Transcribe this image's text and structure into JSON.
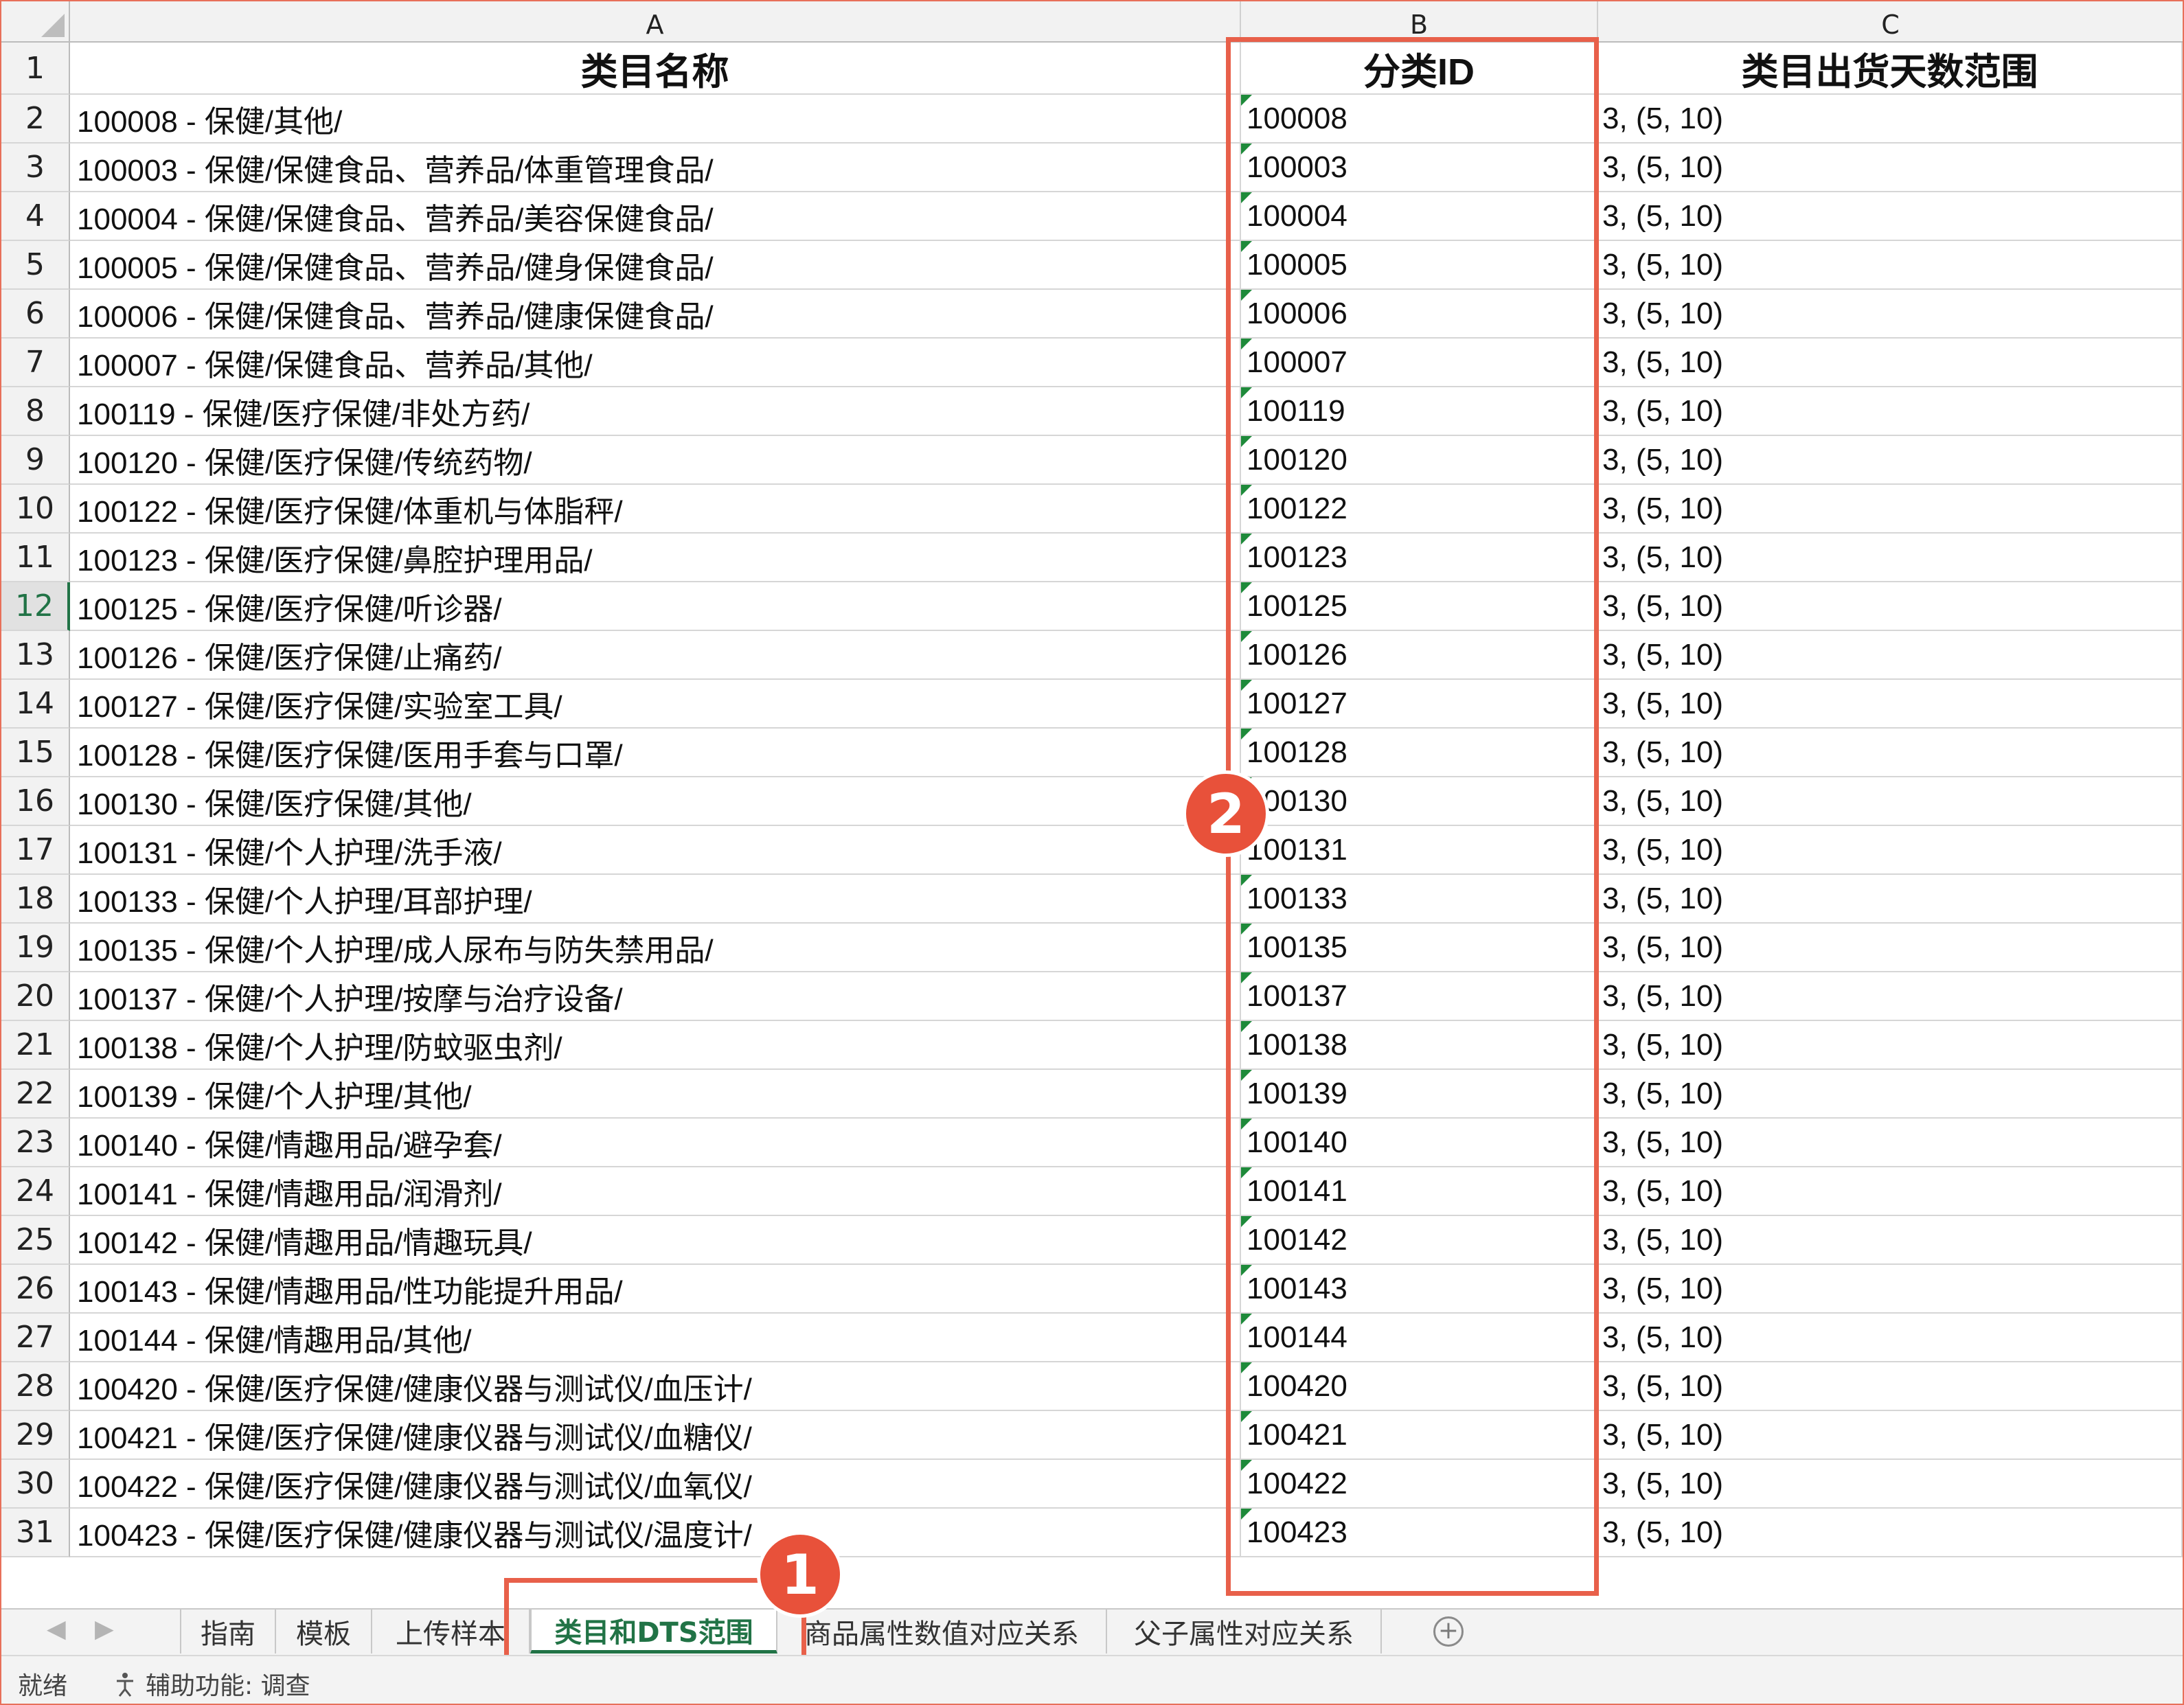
{
  "columns": [
    "A",
    "B",
    "C"
  ],
  "headers": {
    "a": "类目名称",
    "b": "分类ID",
    "c": "类目出货天数范围"
  },
  "active_row": "12",
  "rows": [
    {
      "n": "2",
      "a": "100008 - 保健/其他/",
      "b": "100008",
      "c": "3, (5, 10)"
    },
    {
      "n": "3",
      "a": "100003 - 保健/保健食品、营养品/体重管理食品/",
      "b": "100003",
      "c": "3, (5, 10)"
    },
    {
      "n": "4",
      "a": "100004 - 保健/保健食品、营养品/美容保健食品/",
      "b": "100004",
      "c": "3, (5, 10)"
    },
    {
      "n": "5",
      "a": "100005 - 保健/保健食品、营养品/健身保健食品/",
      "b": "100005",
      "c": "3, (5, 10)"
    },
    {
      "n": "6",
      "a": "100006 - 保健/保健食品、营养品/健康保健食品/",
      "b": "100006",
      "c": "3, (5, 10)"
    },
    {
      "n": "7",
      "a": "100007 - 保健/保健食品、营养品/其他/",
      "b": "100007",
      "c": "3, (5, 10)"
    },
    {
      "n": "8",
      "a": "100119 - 保健/医疗保健/非处方药/",
      "b": "100119",
      "c": "3, (5, 10)"
    },
    {
      "n": "9",
      "a": "100120 - 保健/医疗保健/传统药物/",
      "b": "100120",
      "c": "3, (5, 10)"
    },
    {
      "n": "10",
      "a": "100122 - 保健/医疗保健/体重机与体脂秤/",
      "b": "100122",
      "c": "3, (5, 10)"
    },
    {
      "n": "11",
      "a": "100123 - 保健/医疗保健/鼻腔护理用品/",
      "b": "100123",
      "c": "3, (5, 10)"
    },
    {
      "n": "12",
      "a": "100125 - 保健/医疗保健/听诊器/",
      "b": "100125",
      "c": "3, (5, 10)"
    },
    {
      "n": "13",
      "a": "100126 - 保健/医疗保健/止痛药/",
      "b": "100126",
      "c": "3, (5, 10)"
    },
    {
      "n": "14",
      "a": "100127 - 保健/医疗保健/实验室工具/",
      "b": "100127",
      "c": "3, (5, 10)"
    },
    {
      "n": "15",
      "a": "100128 - 保健/医疗保健/医用手套与口罩/",
      "b": "100128",
      "c": "3, (5, 10)"
    },
    {
      "n": "16",
      "a": "100130 - 保健/医疗保健/其他/",
      "b": "100130",
      "c": "3, (5, 10)"
    },
    {
      "n": "17",
      "a": "100131 - 保健/个人护理/洗手液/",
      "b": "100131",
      "c": "3, (5, 10)"
    },
    {
      "n": "18",
      "a": "100133 - 保健/个人护理/耳部护理/",
      "b": "100133",
      "c": "3, (5, 10)"
    },
    {
      "n": "19",
      "a": "100135 - 保健/个人护理/成人尿布与防失禁用品/",
      "b": "100135",
      "c": "3, (5, 10)"
    },
    {
      "n": "20",
      "a": "100137 - 保健/个人护理/按摩与治疗设备/",
      "b": "100137",
      "c": "3, (5, 10)"
    },
    {
      "n": "21",
      "a": "100138 - 保健/个人护理/防蚊驱虫剂/",
      "b": "100138",
      "c": "3, (5, 10)"
    },
    {
      "n": "22",
      "a": "100139 - 保健/个人护理/其他/",
      "b": "100139",
      "c": "3, (5, 10)"
    },
    {
      "n": "23",
      "a": "100140 - 保健/情趣用品/避孕套/",
      "b": "100140",
      "c": "3, (5, 10)"
    },
    {
      "n": "24",
      "a": "100141 - 保健/情趣用品/润滑剂/",
      "b": "100141",
      "c": "3, (5, 10)"
    },
    {
      "n": "25",
      "a": "100142 - 保健/情趣用品/情趣玩具/",
      "b": "100142",
      "c": "3, (5, 10)"
    },
    {
      "n": "26",
      "a": "100143 - 保健/情趣用品/性功能提升用品/",
      "b": "100143",
      "c": "3, (5, 10)"
    },
    {
      "n": "27",
      "a": "100144 - 保健/情趣用品/其他/",
      "b": "100144",
      "c": "3, (5, 10)"
    },
    {
      "n": "28",
      "a": "100420 - 保健/医疗保健/健康仪器与测试仪/血压计/",
      "b": "100420",
      "c": "3, (5, 10)"
    },
    {
      "n": "29",
      "a": "100421 - 保健/医疗保健/健康仪器与测试仪/血糖仪/",
      "b": "100421",
      "c": "3, (5, 10)"
    },
    {
      "n": "30",
      "a": "100422 - 保健/医疗保健/健康仪器与测试仪/血氧仪/",
      "b": "100422",
      "c": "3, (5, 10)"
    },
    {
      "n": "31",
      "a": "100423 - 保健/医疗保健/健康仪器与测试仪/温度计/",
      "b": "100423",
      "c": "3, (5, 10)"
    }
  ],
  "tabs": [
    "指南",
    "模板",
    "上传样本",
    "类目和DTS范围",
    "商品属性数值对应关系",
    "父子属性对应关系"
  ],
  "active_tab": "类目和DTS范围",
  "tab_add": "+",
  "nav": {
    "prev": "◀",
    "next": "▶"
  },
  "status": {
    "ready": "就绪",
    "accessibility": "辅助功能: 调查"
  },
  "annotations": {
    "badge1": "1",
    "badge2": "2"
  },
  "colors": {
    "accent": "#e8604a",
    "excel_green": "#217346",
    "badge": "#e8513a"
  }
}
